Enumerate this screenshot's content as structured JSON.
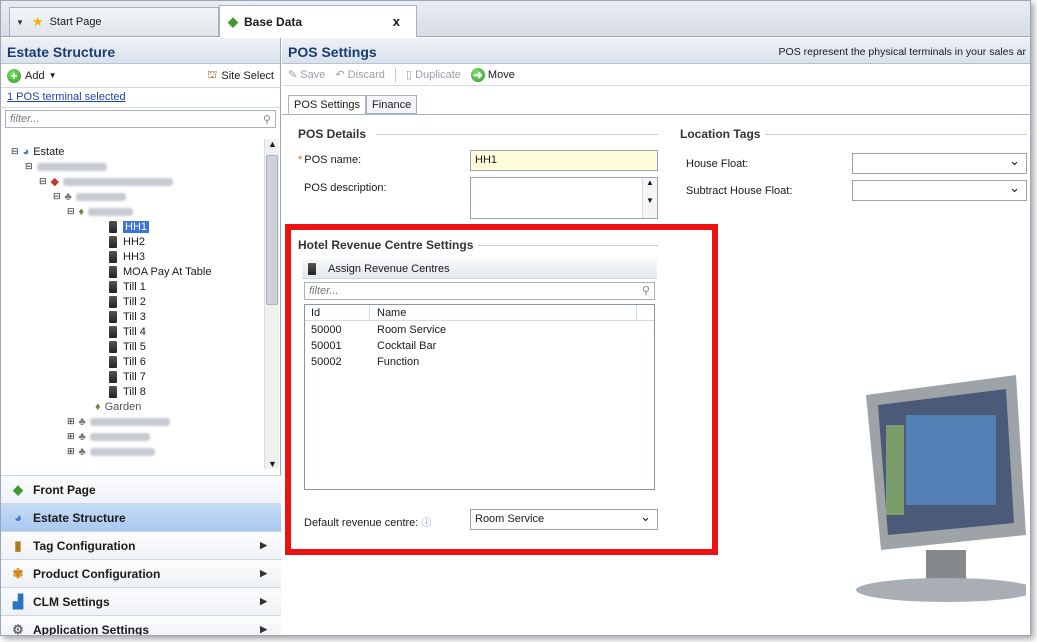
{
  "tabs": {
    "start_page": "Start Page",
    "base_data": "Base Data",
    "close_glyph": "x"
  },
  "left": {
    "title": "Estate Structure",
    "add_label": "Add",
    "site_select_label": "Site Select",
    "selection_text": "1 POS terminal selected",
    "filter_placeholder": "filter...",
    "tree": {
      "root": "Estate",
      "terminals": [
        "HH1",
        "HH2",
        "HH3",
        "MOA Pay At Table",
        "Till 1",
        "Till 2",
        "Till 3",
        "Till 4",
        "Till 5",
        "Till 6",
        "Till 7",
        "Till 8"
      ],
      "garden": "Garden"
    },
    "nav": [
      {
        "label": "Front Page"
      },
      {
        "label": "Estate Structure"
      },
      {
        "label": "Tag Configuration"
      },
      {
        "label": "Product Configuration"
      },
      {
        "label": "CLM Settings"
      },
      {
        "label": "Application Settings"
      }
    ]
  },
  "right": {
    "title": "POS Settings",
    "description": "POS represent the physical terminals in your sales ar",
    "toolbar": {
      "save": "Save",
      "discard": "Discard",
      "duplicate": "Duplicate",
      "move": "Move"
    },
    "subtabs": [
      "POS Settings",
      "Finance"
    ],
    "pos_details": {
      "group": "POS Details",
      "name_label": "POS name:",
      "name_value": "HH1",
      "description_label": "POS description:"
    },
    "location_tags": {
      "group": "Location Tags",
      "house_float_label": "House Float:",
      "subtract_label": "Subtract House Float:"
    },
    "hotel": {
      "group": "Hotel Revenue Centre Settings",
      "assign_label": "Assign Revenue Centres",
      "filter_placeholder": "filter...",
      "columns": [
        "Id",
        "Name"
      ],
      "rows": [
        {
          "id": "50000",
          "name": "Room Service"
        },
        {
          "id": "50001",
          "name": "Cocktail Bar"
        },
        {
          "id": "50002",
          "name": "Function"
        }
      ],
      "default_label": "Default revenue centre:",
      "default_value": "Room Service"
    }
  }
}
